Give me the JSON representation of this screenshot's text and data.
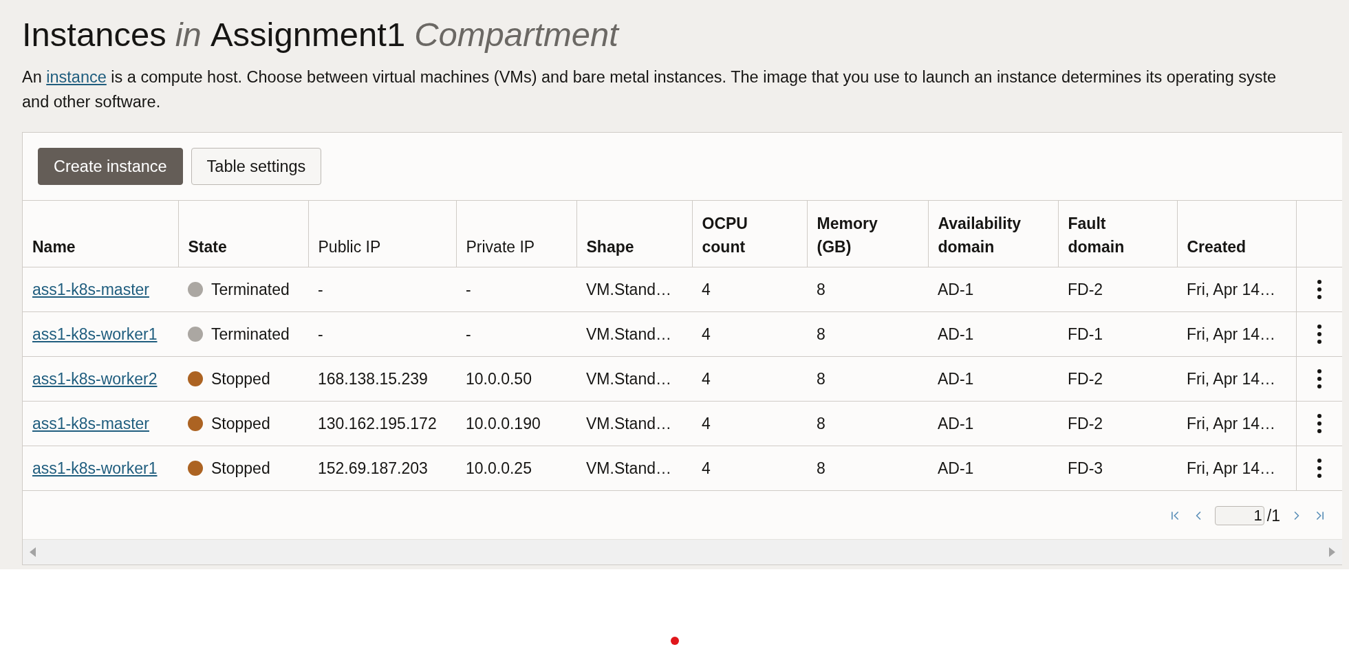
{
  "header": {
    "title_parts": [
      {
        "text": "Instances",
        "italic": false
      },
      {
        "text": "in",
        "italic": true
      },
      {
        "text": "Assignment1",
        "italic": false
      },
      {
        "text": "Compartment",
        "italic": true
      }
    ],
    "description_before": "An",
    "description_link": "instance",
    "description_after": "is a compute host. Choose between virtual machines (VMs) and bare metal instances. The image that you use to launch an instance determines its operating syste",
    "description_line2": "and other software."
  },
  "toolbar": {
    "buttons": [
      {
        "label": "Create instance",
        "kind": "primary"
      },
      {
        "label": "Table settings",
        "kind": "secondary"
      }
    ]
  },
  "table": {
    "columns": [
      {
        "label": "Name",
        "bold": true
      },
      {
        "label": "State",
        "bold": true
      },
      {
        "label": "Public IP",
        "bold": false
      },
      {
        "label": "Private IP",
        "bold": false
      },
      {
        "label": "Shape",
        "bold": true
      },
      {
        "label": "OCPU count",
        "bold": true
      },
      {
        "label": "Memory (GB)",
        "bold": true
      },
      {
        "label": "Availability domain",
        "bold": true
      },
      {
        "label": "Fault domain",
        "bold": true
      },
      {
        "label": "Created",
        "bold": true
      }
    ],
    "rows": [
      {
        "name": "ass1-k8s-master",
        "state": "Terminated",
        "color": "#aba7a2",
        "public_ip": "-",
        "private_ip": "-",
        "shape": "VM.Stand…",
        "ocpu": "4",
        "memory": "8",
        "availability_domain": "AD-1",
        "fault_domain": "FD-2",
        "created": "Fri, Apr 14…"
      },
      {
        "name": "ass1-k8s-worker1",
        "state": "Terminated",
        "color": "#aba7a2",
        "public_ip": "-",
        "private_ip": "-",
        "shape": "VM.Stand…",
        "ocpu": "4",
        "memory": "8",
        "availability_domain": "AD-1",
        "fault_domain": "FD-1",
        "created": "Fri, Apr 14…"
      },
      {
        "name": "ass1-k8s-worker2",
        "state": "Stopped",
        "color": "#ac6322",
        "public_ip": "168.138.15.239",
        "private_ip": "10.0.0.50",
        "shape": "VM.Stand…",
        "ocpu": "4",
        "memory": "8",
        "availability_domain": "AD-1",
        "fault_domain": "FD-2",
        "created": "Fri, Apr 14…"
      },
      {
        "name": "ass1-k8s-master",
        "state": "Stopped",
        "color": "#ac6322",
        "public_ip": "130.162.195.172",
        "private_ip": "10.0.0.190",
        "shape": "VM.Stand…",
        "ocpu": "4",
        "memory": "8",
        "availability_domain": "AD-1",
        "fault_domain": "FD-2",
        "created": "Fri, Apr 14…"
      },
      {
        "name": "ass1-k8s-worker1",
        "state": "Stopped",
        "color": "#ac6322",
        "public_ip": "152.69.187.203",
        "private_ip": "10.0.0.25",
        "shape": "VM.Stand…",
        "ocpu": "4",
        "memory": "8",
        "availability_domain": "AD-1",
        "fault_domain": "FD-3",
        "created": "Fri, Apr 14…"
      }
    ]
  },
  "pagination": {
    "page": "1",
    "total": "/1"
  }
}
